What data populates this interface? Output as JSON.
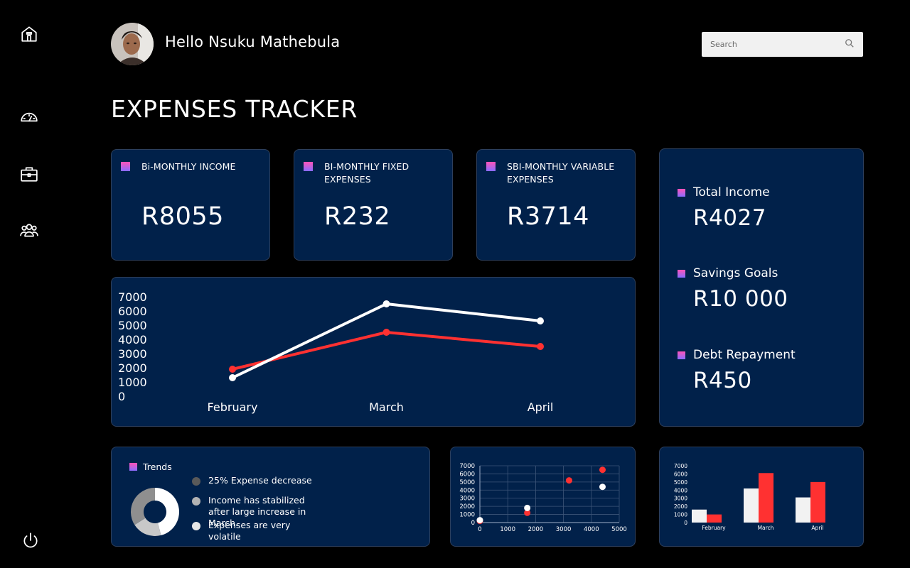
{
  "header": {
    "greeting": "Hello Nsuku Mathebula",
    "search_placeholder": "Search",
    "title": "EXPENSES TRACKER"
  },
  "sidebar": {
    "items": [
      {
        "icon": "home-icon"
      },
      {
        "icon": "speedometer-icon"
      },
      {
        "icon": "briefcase-icon"
      },
      {
        "icon": "users-icon"
      },
      {
        "icon": "power-icon"
      }
    ]
  },
  "stats": [
    {
      "label": "Bi-MONTHLY INCOME",
      "value": "R8055"
    },
    {
      "label": "BI-MONTHLY FIXED EXPENSES",
      "value": "R232"
    },
    {
      "label": "SBI-MONTHLY VARIABLE EXPENSES",
      "value": "R3714"
    }
  ],
  "summary": [
    {
      "label": "Total Income",
      "value": "R4027"
    },
    {
      "label": "Savings Goals",
      "value": "R10 000"
    },
    {
      "label": "Debt Repayment",
      "value": "R450"
    }
  ],
  "trends": {
    "title": "Trends",
    "items": [
      {
        "text": "25% Expense decrease",
        "color": "#5a5a5a"
      },
      {
        "text": "Income has stabilized after large increase in March.",
        "color": "#b3b3b3"
      },
      {
        "text": "Expenses are very volatile",
        "color": "#e6e6e6"
      }
    ],
    "donut": {
      "segments": [
        0.46,
        0.2,
        0.34
      ],
      "colors": [
        "#ffffff",
        "#c8c8c8",
        "#8f8f8f"
      ]
    }
  },
  "colors": {
    "card_bg": "#01214a",
    "red": "#ff3131",
    "white": "#ffffff"
  },
  "chart_data": [
    {
      "type": "line",
      "categories": [
        "February",
        "March",
        "April"
      ],
      "yticks": [
        0,
        1000,
        2000,
        3000,
        4000,
        5000,
        6000,
        7000
      ],
      "ylim": [
        0,
        7000
      ],
      "series": [
        {
          "values": [
            1900,
            4500,
            3500
          ],
          "color": "#ff3131"
        },
        {
          "values": [
            1300,
            6500,
            5300
          ],
          "color": "#ffffff"
        }
      ]
    },
    {
      "type": "scatter",
      "xticks": [
        0,
        1000,
        2000,
        3000,
        4000,
        5000
      ],
      "yticks": [
        0,
        1000,
        2000,
        3000,
        4000,
        5000,
        6000,
        7000
      ],
      "xlim": [
        0,
        5000
      ],
      "ylim": [
        0,
        7000
      ],
      "grid": true,
      "series": [
        {
          "points": [
            [
              0,
              200
            ],
            [
              1700,
              1200
            ],
            [
              3200,
              5200
            ],
            [
              4400,
              6500
            ]
          ],
          "color": "#ff3131"
        },
        {
          "points": [
            [
              0,
              300
            ],
            [
              1700,
              1800
            ],
            [
              4400,
              4400
            ]
          ],
          "color": "#ffffff"
        }
      ]
    },
    {
      "type": "bar",
      "categories": [
        "February",
        "March",
        "April"
      ],
      "yticks": [
        0,
        1000,
        2000,
        3000,
        4000,
        5000,
        6000,
        7000
      ],
      "ylim": [
        0,
        7000
      ],
      "series": [
        {
          "values": [
            1600,
            4200,
            3100
          ],
          "color": "#f2f2f2"
        },
        {
          "values": [
            1000,
            6100,
            5000
          ],
          "color": "#ff3131"
        }
      ]
    }
  ]
}
